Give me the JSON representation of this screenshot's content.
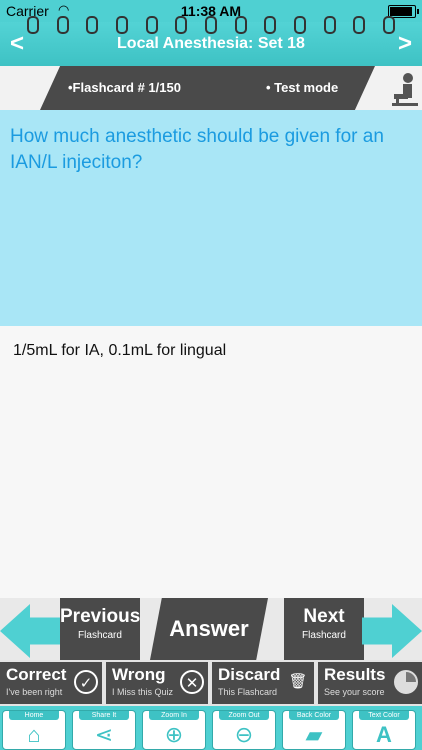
{
  "status": {
    "carrier": "Carrier",
    "time": "11:38 AM"
  },
  "title_bar": {
    "title": "Local Anesthesia: Set 18",
    "prev_icon": "chevron-left",
    "next_icon": "chevron-right"
  },
  "info": {
    "flashcard": "•Flashcard #  1/150",
    "mode": "• Test mode"
  },
  "card": {
    "question": "How much anesthetic should be given for an IAN/L injeciton?",
    "answer": "1/5mL for IA, 0.1mL for lingual"
  },
  "nav": {
    "previous": {
      "label": "Previous",
      "sub": "Flashcard"
    },
    "answer": {
      "label": "Answer"
    },
    "next": {
      "label": "Next",
      "sub": "Flashcard"
    }
  },
  "results": [
    {
      "label": "Correct",
      "sub": "I've been right",
      "icon": "check-icon"
    },
    {
      "label": "Wrong",
      "sub": "I Miss this Quiz",
      "icon": "x-icon"
    },
    {
      "label": "Discard",
      "sub": "This Flashcard",
      "icon": "trash-icon"
    },
    {
      "label": "Results",
      "sub": "See your score",
      "icon": "pie-icon"
    }
  ],
  "tools": [
    {
      "label": "Home",
      "icon": "home-icon"
    },
    {
      "label": "Share It",
      "icon": "share-icon"
    },
    {
      "label": "Zoom In",
      "icon": "zoom-in-icon"
    },
    {
      "label": "Zoom Out",
      "icon": "zoom-out-icon"
    },
    {
      "label": "Back Color",
      "icon": "paint-bucket-icon"
    },
    {
      "label": "Text Color",
      "icon": "text-color-icon"
    }
  ],
  "colors": {
    "accent": "#4fd0d2",
    "dark": "#4a4a4a",
    "question_bg": "#a9e6f6",
    "question_text": "#1b9be0"
  }
}
